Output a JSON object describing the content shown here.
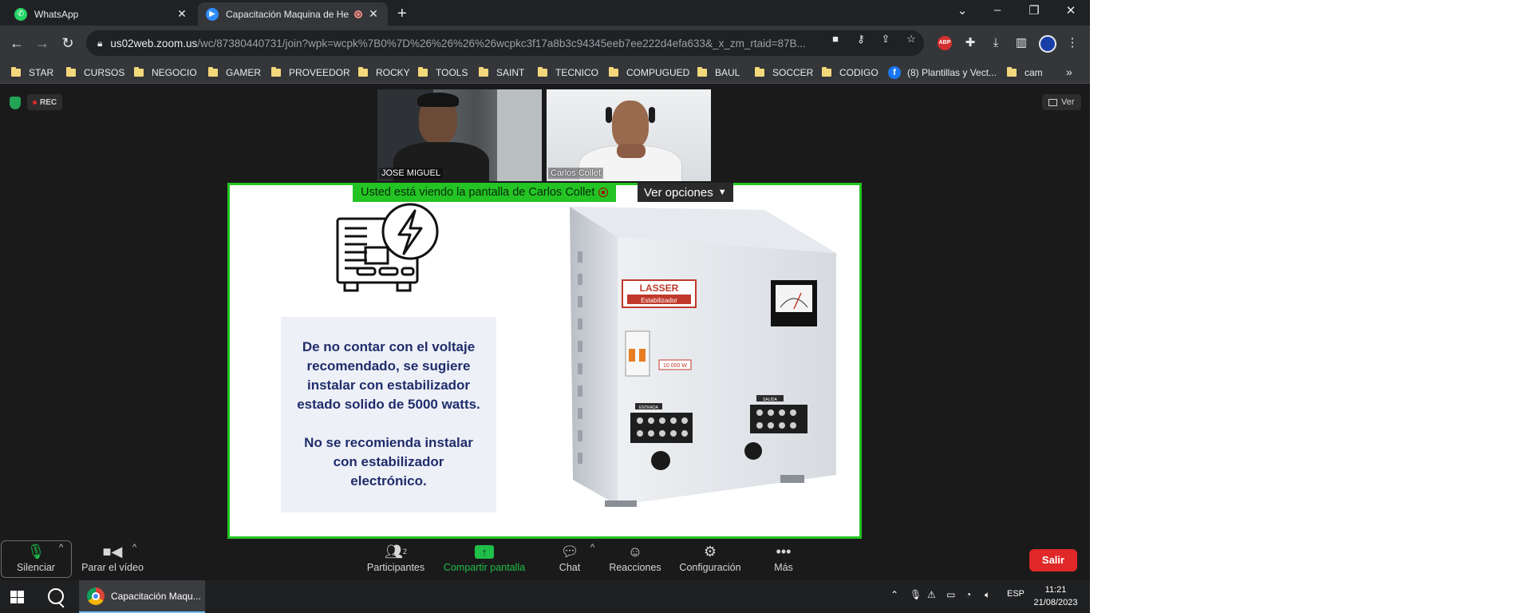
{
  "browser": {
    "tabs": [
      {
        "title": "WhatsApp",
        "icon": "whatsapp-icon",
        "active": false
      },
      {
        "title": "Capacitación Maquina de He",
        "icon": "zoom-icon",
        "active": true,
        "recording": true
      }
    ],
    "url_host": "us02web.zoom.us",
    "url_path": "/wc/87380440731/join?wpk=wcpk%7B0%7D%26%26%26%26wcpkc3f17a8b3c94345eeb7ee222d4efa633&_x_zm_rtaid=87B...",
    "extension_abp": "ABP",
    "bookmarks": [
      "STAR",
      "CURSOS",
      "NEGOCIO",
      "GAMER",
      "PROVEEDOR",
      "ROCKY",
      "TOOLS",
      "SAINT",
      "TECNICO",
      "COMPUGUED",
      "BAUL",
      "SOCCER",
      "CODIGO",
      "(8) Plantillas y Vect...",
      "cam"
    ]
  },
  "meeting": {
    "rec_label": "REC",
    "view_label": "Ver",
    "participants": [
      "JOSE MIGUEL",
      "Carlos Collet"
    ],
    "share_banner": "Usted está viendo la pantalla de Carlos Collet",
    "view_options": "Ver opciones",
    "slide": {
      "paragraph1": "De no contar con el voltaje recomendado, se sugiere instalar con estabilizador estado solido de 5000 watts.",
      "paragraph2": "No se recomienda instalar con estabilizador electrónico.",
      "brand": "LASSER",
      "brand_sub": "Estabilizador",
      "power_tag": "10 000 W",
      "in_label": "ENTRADA",
      "out_label": "SALIDA"
    },
    "controls": {
      "mute": "Silenciar",
      "video": "Parar el vídeo",
      "participants": "Participantes",
      "participants_count": "2",
      "share": "Compartir pantalla",
      "chat": "Chat",
      "reactions": "Reacciones",
      "settings": "Configuración",
      "more": "Más",
      "leave": "Salir"
    },
    "colors": {
      "share_green": "#23c423",
      "leave_red": "#e02828",
      "slide_text": "#1f2d6a"
    }
  },
  "taskbar": {
    "app_title": "Capacitación Maqu...",
    "lang": "ESP",
    "time": "11:21",
    "date": "21/08/2023"
  }
}
